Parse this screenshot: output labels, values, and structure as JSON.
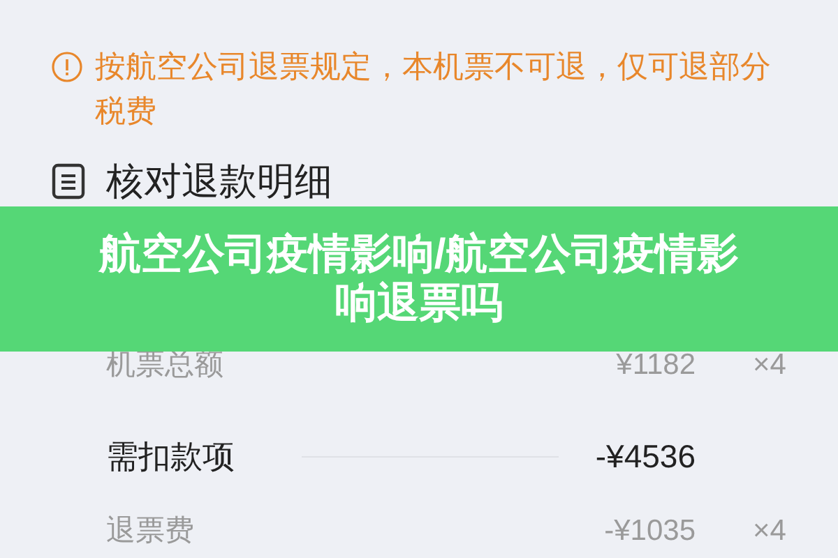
{
  "notice": {
    "text": "按航空公司退票规定，本机票不可退，仅可退部分税费"
  },
  "section": {
    "title": "核对退款明细"
  },
  "rows": [
    {
      "kind": "detail",
      "label": "机票总额",
      "amount": "¥1182",
      "quantity": "×4"
    },
    {
      "kind": "item",
      "label": "需扣款项",
      "amount": "-¥4536"
    },
    {
      "kind": "detail",
      "label": "退票费",
      "amount": "-¥1035",
      "quantity": "×4"
    }
  ],
  "banner": {
    "text": "航空公司疫情影响/航空公司疫情影响退票吗"
  }
}
